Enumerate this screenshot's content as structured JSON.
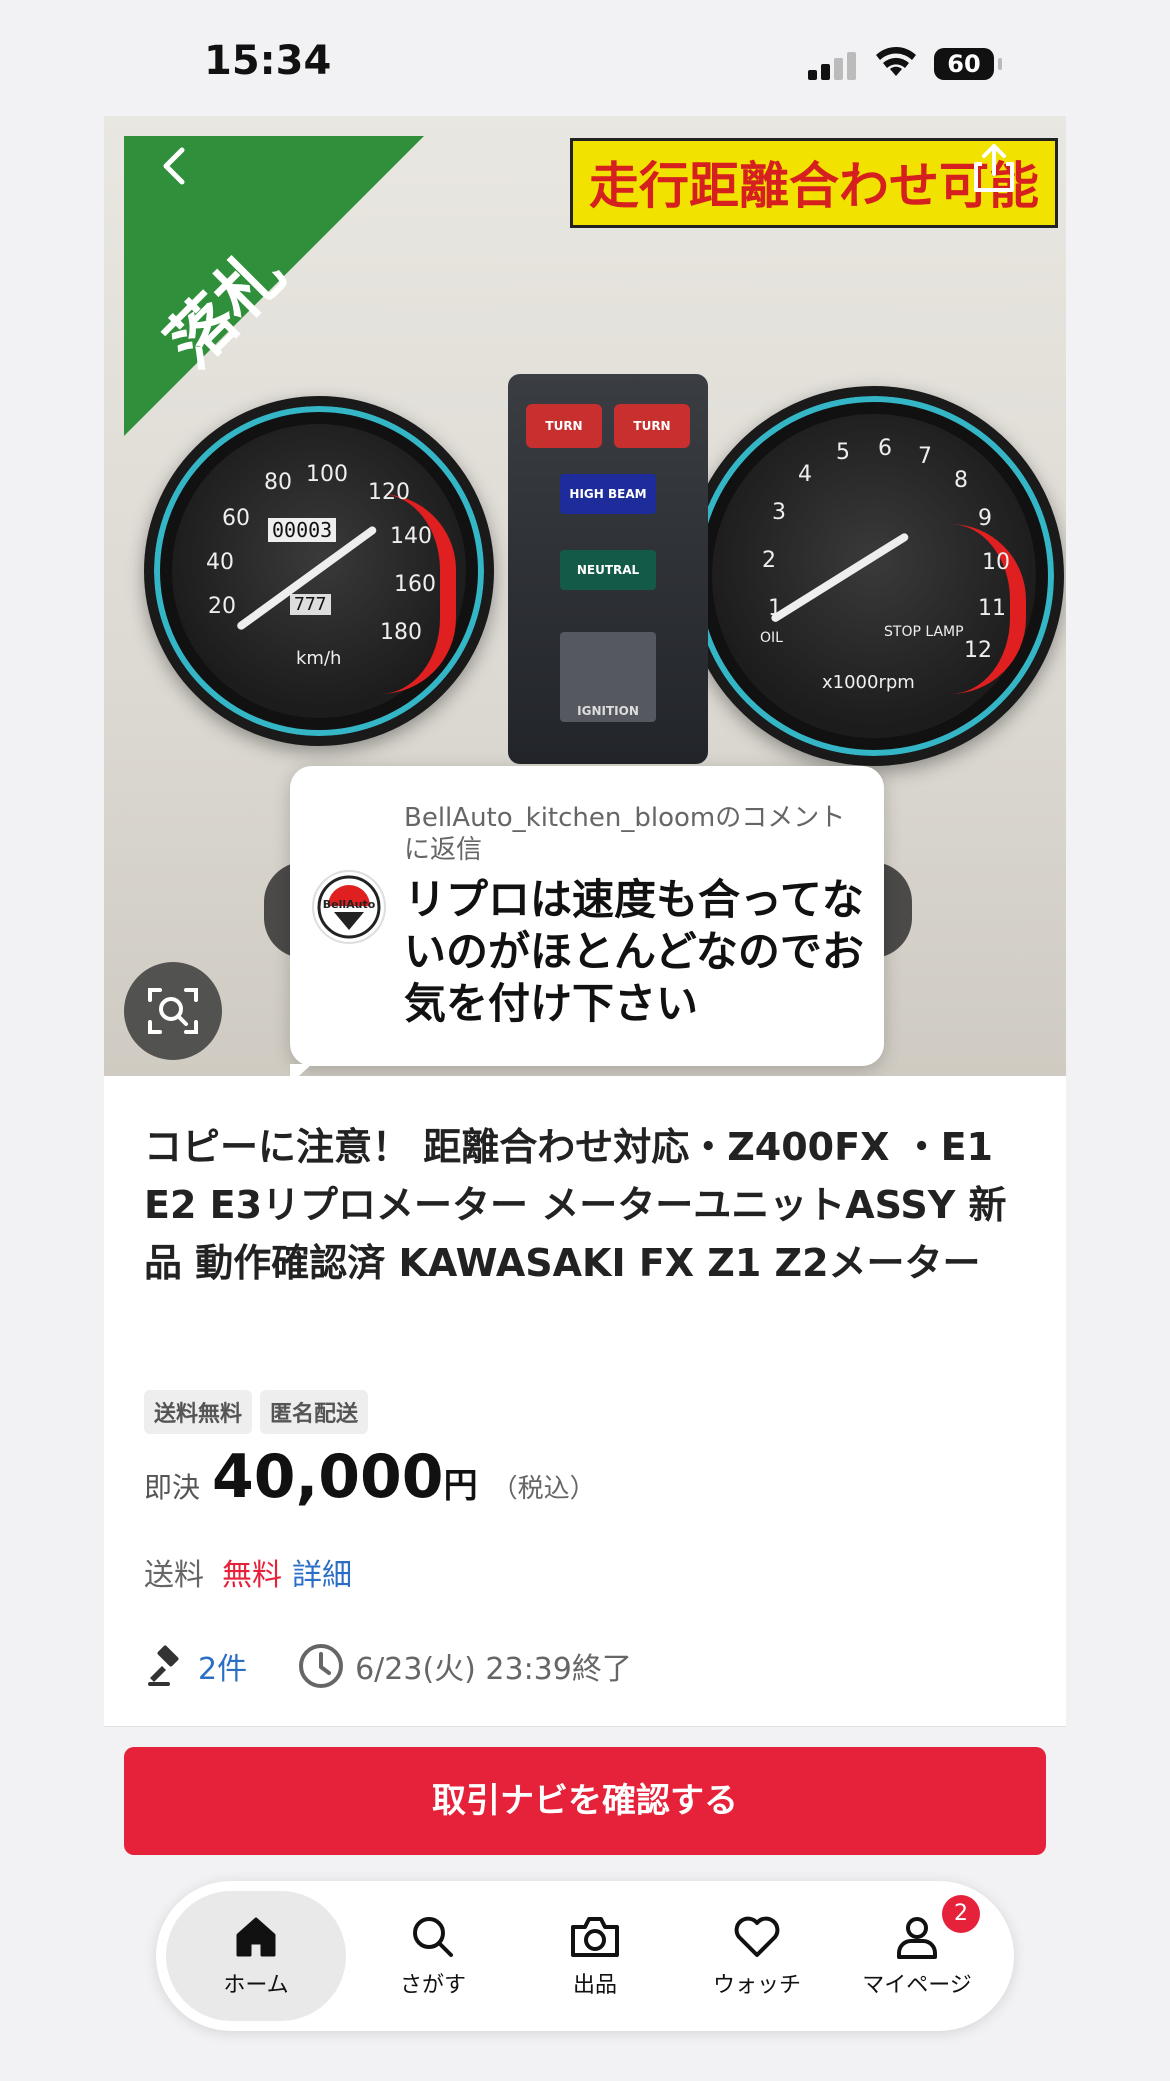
{
  "status_bar": {
    "time": "15:34",
    "battery": "60"
  },
  "hero": {
    "banner": "走行距離合わせ可能",
    "sold_label": "落札",
    "lamps": {
      "turn_left": "TURN",
      "turn_right": "TURN",
      "high_beam": "HIGH BEAM",
      "neutral": "NEUTRAL",
      "ignition": "IGNITION"
    },
    "speedo": {
      "ticks": [
        "20",
        "40",
        "60",
        "80",
        "100",
        "120",
        "140",
        "160",
        "180"
      ],
      "odometer": "00003",
      "trip": "777",
      "unit": "km/h"
    },
    "tacho": {
      "ticks": [
        "1",
        "2",
        "3",
        "4",
        "5",
        "6",
        "7",
        "8",
        "9",
        "10",
        "11",
        "12"
      ],
      "oil": "OIL",
      "stop_lamp": "STOP LAMP",
      "unit": "x1000rpm"
    }
  },
  "comment": {
    "reply_to": "BellAuto_kitchen_bloomのコメントに返信",
    "message": "リプロは速度も合ってないのがほとんどなのでお気を付け下さい",
    "avatar_text": "BellAuto"
  },
  "listing": {
    "title": "コピーに注意！ 距離合わせ対応・Z400FX ・E1 E2 E3リプロメーター メーターユニットASSY 新品 動作確認済 KAWASAKI FX Z1 Z2メーター",
    "tags": [
      "送料無料",
      "匿名配送"
    ],
    "price_label": "即決",
    "price": "40,000",
    "currency": "円",
    "tax_note": "（税込）",
    "shipping_label": "送料",
    "shipping_value": "無料",
    "shipping_detail": "詳細",
    "bids": "2件",
    "end_time": "6/23(火) 23:39終了"
  },
  "cta_label": "取引ナビを確認する",
  "tabs": [
    {
      "label": "ホーム",
      "icon": "home-icon"
    },
    {
      "label": "さがす",
      "icon": "search-icon"
    },
    {
      "label": "出品",
      "icon": "camera-icon"
    },
    {
      "label": "ウォッチ",
      "icon": "heart-icon"
    },
    {
      "label": "マイページ",
      "icon": "person-icon",
      "badge": "2"
    }
  ],
  "colors": {
    "accent": "#e6213a",
    "link": "#2a6ec6",
    "sold": "#2f8f3a"
  }
}
